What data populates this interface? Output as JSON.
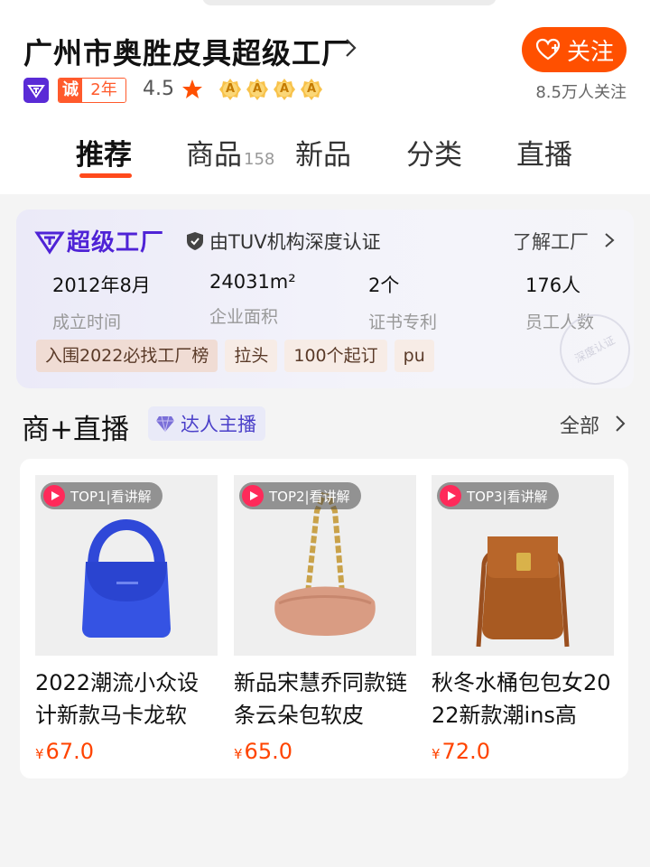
{
  "shop": {
    "title": "广州市奥胜皮具超级工厂",
    "badge_cheng": "诚",
    "badge_years": "2年",
    "rating": "4.5",
    "medal_letter": "A",
    "medal_count": 4,
    "follow_label": "关注",
    "followers": "8.5万人关注"
  },
  "tabs": [
    {
      "label": "推荐",
      "count": ""
    },
    {
      "label": "商品",
      "count": "158"
    },
    {
      "label": "新品",
      "count": ""
    },
    {
      "label": "分类",
      "count": ""
    },
    {
      "label": "直播",
      "count": ""
    }
  ],
  "factory": {
    "title": "超级工厂",
    "cert": "由TUV机构深度认证",
    "more": "了解工厂",
    "stats": [
      {
        "value": "2012年8月",
        "label": "成立时间"
      },
      {
        "value": "24031m²",
        "label": "企业面积"
      },
      {
        "value": "2个",
        "label": "证书专利"
      },
      {
        "value": "176人",
        "label": "员工人数"
      }
    ],
    "tags": [
      "入围2022必找工厂榜",
      "拉头",
      "100个起订",
      "pu"
    ],
    "stamp": "深度认证"
  },
  "live_section": {
    "title": "商+直播",
    "talent": "达人主播",
    "all": "全部"
  },
  "products": [
    {
      "tag": "TOP1|看讲解",
      "name": "2022潮流小众设计新款马卡龙软",
      "currency": "¥",
      "price": "67.0"
    },
    {
      "tag": "TOP2|看讲解",
      "name": "新品宋慧乔同款链条云朵包软皮",
      "currency": "¥",
      "price": "65.0"
    },
    {
      "tag": "TOP3|看讲解",
      "name": "秋冬水桶包包女2022新款潮ins高",
      "currency": "¥",
      "price": "72.0"
    }
  ],
  "colors": {
    "accent": "#ff5000",
    "factory_purple": "#4f23d6",
    "price": "#ff4400"
  }
}
